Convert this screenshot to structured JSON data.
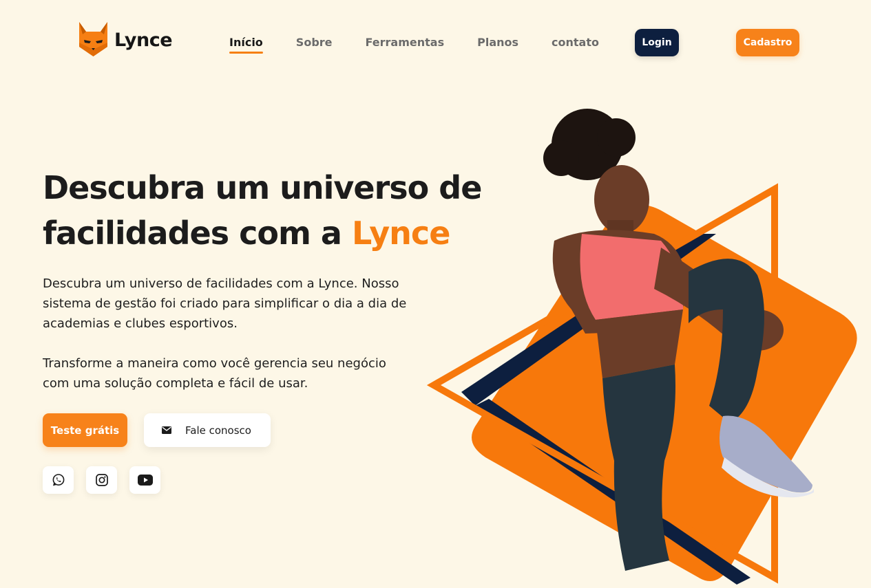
{
  "brand": {
    "name": "Lynce",
    "accent_color": "#f67f13",
    "dark_color": "#0d1f3f"
  },
  "nav": {
    "items": [
      {
        "label": "Início",
        "active": true
      },
      {
        "label": "Sobre",
        "active": false
      },
      {
        "label": "Ferramentas",
        "active": false
      },
      {
        "label": "Planos",
        "active": false
      },
      {
        "label": "contato",
        "active": false
      }
    ],
    "login_label": "Login",
    "signup_label": "Cadastro"
  },
  "hero": {
    "title_line1": "Descubra um universo de",
    "title_line2_prefix": "facilidades com a ",
    "title_accent": "Lynce",
    "paragraph1": "Descubra um universo de facilidades com a Lynce. Nosso sistema de gestão foi criado para simplificar o dia a dia de academias e clubes esportivos.",
    "paragraph2": "Transforme a maneira como você gerencia seu negócio com uma solução completa e fácil de usar.",
    "trial_button": "Teste grátis",
    "contact_button": "Fale conosco",
    "contact_icon": "envelope-icon",
    "social": [
      "whatsapp-icon",
      "instagram-icon",
      "youtube-icon"
    ]
  },
  "illustration": {
    "subject": "athlete stretching",
    "shapes": [
      "orange-rounded-diamond",
      "orange-outline-triangle",
      "navy-stripe"
    ]
  }
}
